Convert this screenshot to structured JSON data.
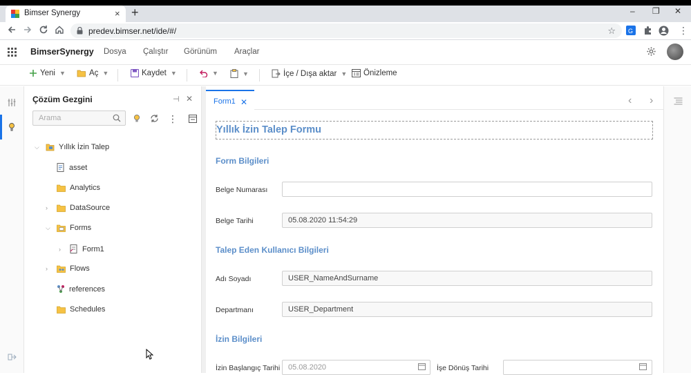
{
  "browser": {
    "tab_title": "Bimser Synergy",
    "tab_close": "×",
    "new_tab": "+",
    "url": "predev.bimser.net/ide/#/",
    "window_controls": [
      "–",
      "❐",
      "✕"
    ]
  },
  "app": {
    "name": "BimserSynergy",
    "menu": [
      "Dosya",
      "Çalıştır",
      "Görünüm",
      "Araçlar"
    ]
  },
  "toolbar": {
    "new_label": "Yeni",
    "open_label": "Aç",
    "save_label": "Kaydet",
    "import_export_label": "İçe / Dışa aktar",
    "preview_label": "Önizleme"
  },
  "explorer": {
    "title": "Çözüm Gezgini",
    "search_placeholder": "Arama",
    "tree": [
      {
        "label": "Yıllık İzin Talep",
        "level": 0,
        "arrow": "expanded",
        "icon": "project-icon"
      },
      {
        "label": "asset",
        "level": 1,
        "arrow": "none",
        "icon": "asset-icon"
      },
      {
        "label": "Analytics",
        "level": 1,
        "arrow": "none",
        "icon": "folder-icon"
      },
      {
        "label": "DataSource",
        "level": 1,
        "arrow": "collapsed",
        "icon": "folder-icon"
      },
      {
        "label": "Forms",
        "level": 1,
        "arrow": "expanded",
        "icon": "forms-icon"
      },
      {
        "label": "Form1",
        "level": 2,
        "arrow": "collapsed",
        "icon": "form-icon"
      },
      {
        "label": "Flows",
        "level": 1,
        "arrow": "collapsed",
        "icon": "flows-icon"
      },
      {
        "label": "references",
        "level": 1,
        "arrow": "none",
        "icon": "references-icon"
      },
      {
        "label": "Schedules",
        "level": 1,
        "arrow": "none",
        "icon": "folder-icon"
      }
    ]
  },
  "editor": {
    "tab_label": "Form1",
    "tab_close": "✕",
    "pager_prev": "‹",
    "pager_next": "›"
  },
  "form": {
    "title": "Yıllık İzin Talep Formu",
    "section1": "Form Bilgileri",
    "doc_no_label": "Belge Numarası",
    "doc_no_value": "",
    "doc_date_label": "Belge Tarihi",
    "doc_date_value": "05.08.2020 11:54:29",
    "section2": "Talep Eden Kullanıcı Bilgileri",
    "name_label": "Adı Soyadı",
    "name_value": "USER_NameAndSurname",
    "dept_label": "Departmanı",
    "dept_value": "USER_Department",
    "section3": "İzin Bilgileri",
    "start_label": "İzin Başlangıç Tarihi",
    "start_value": "05.08.2020",
    "return_label": "İşe Dönüş Tarihi",
    "return_value": ""
  },
  "colors": {
    "accent": "#1a73e8",
    "heading": "#5b8ec9"
  }
}
